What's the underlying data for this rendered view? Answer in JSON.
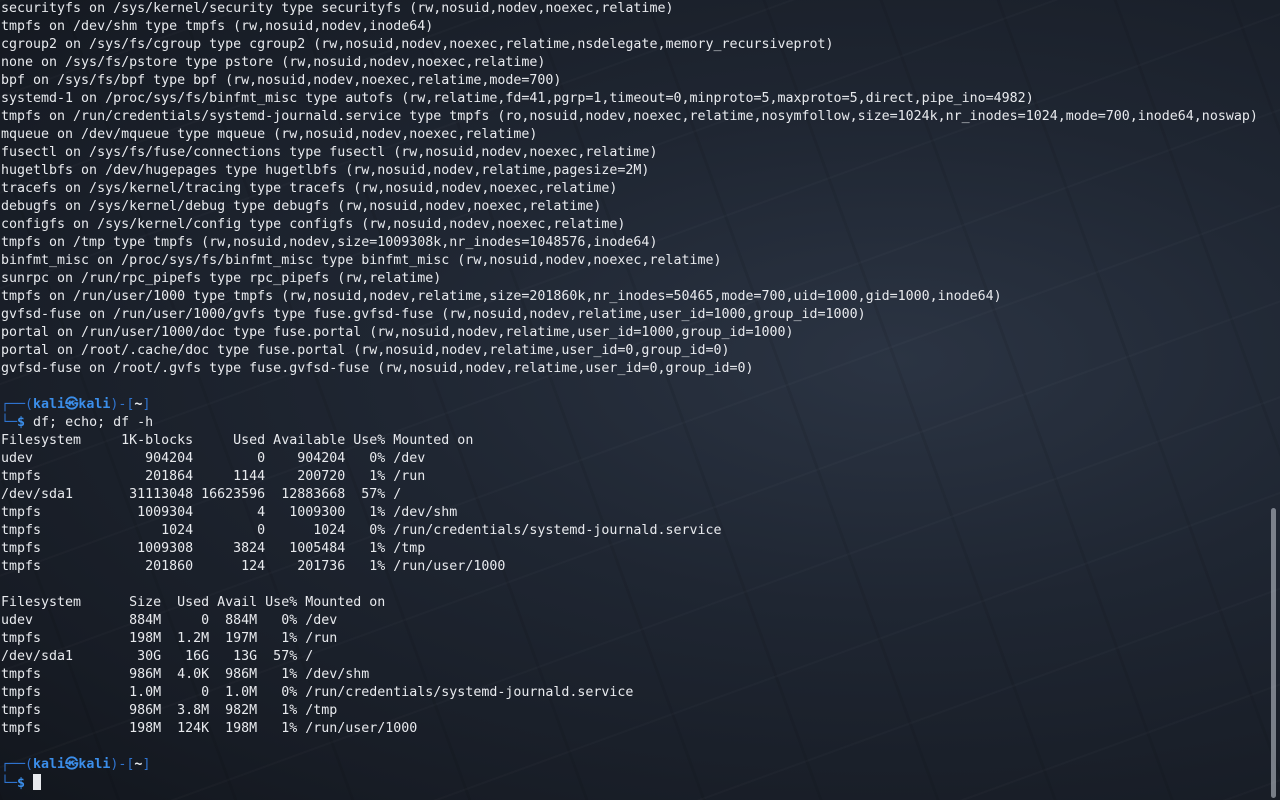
{
  "mount_output": [
    "securityfs on /sys/kernel/security type securityfs (rw,nosuid,nodev,noexec,relatime)",
    "tmpfs on /dev/shm type tmpfs (rw,nosuid,nodev,inode64)",
    "cgroup2 on /sys/fs/cgroup type cgroup2 (rw,nosuid,nodev,noexec,relatime,nsdelegate,memory_recursiveprot)",
    "none on /sys/fs/pstore type pstore (rw,nosuid,nodev,noexec,relatime)",
    "bpf on /sys/fs/bpf type bpf (rw,nosuid,nodev,noexec,relatime,mode=700)",
    "systemd-1 on /proc/sys/fs/binfmt_misc type autofs (rw,relatime,fd=41,pgrp=1,timeout=0,minproto=5,maxproto=5,direct,pipe_ino=4982)",
    "tmpfs on /run/credentials/systemd-journald.service type tmpfs (ro,nosuid,nodev,noexec,relatime,nosymfollow,size=1024k,nr_inodes=1024,mode=700,inode64,noswap)",
    "mqueue on /dev/mqueue type mqueue (rw,nosuid,nodev,noexec,relatime)",
    "fusectl on /sys/fs/fuse/connections type fusectl (rw,nosuid,nodev,noexec,relatime)",
    "hugetlbfs on /dev/hugepages type hugetlbfs (rw,nosuid,nodev,relatime,pagesize=2M)",
    "tracefs on /sys/kernel/tracing type tracefs (rw,nosuid,nodev,noexec,relatime)",
    "debugfs on /sys/kernel/debug type debugfs (rw,nosuid,nodev,noexec,relatime)",
    "configfs on /sys/kernel/config type configfs (rw,nosuid,nodev,noexec,relatime)",
    "tmpfs on /tmp type tmpfs (rw,nosuid,nodev,size=1009308k,nr_inodes=1048576,inode64)",
    "binfmt_misc on /proc/sys/fs/binfmt_misc type binfmt_misc (rw,nosuid,nodev,noexec,relatime)",
    "sunrpc on /run/rpc_pipefs type rpc_pipefs (rw,relatime)",
    "tmpfs on /run/user/1000 type tmpfs (rw,nosuid,nodev,relatime,size=201860k,nr_inodes=50465,mode=700,uid=1000,gid=1000,inode64)",
    "gvfsd-fuse on /run/user/1000/gvfs type fuse.gvfsd-fuse (rw,nosuid,nodev,relatime,user_id=1000,group_id=1000)",
    "portal on /run/user/1000/doc type fuse.portal (rw,nosuid,nodev,relatime,user_id=1000,group_id=1000)",
    "portal on /root/.cache/doc type fuse.portal (rw,nosuid,nodev,relatime,user_id=0,group_id=0)",
    "gvfsd-fuse on /root/.gvfs type fuse.gvfsd-fuse (rw,nosuid,nodev,relatime,user_id=0,group_id=0)"
  ],
  "prompt": {
    "top_open": "┌──(",
    "user": "kali",
    "at": "㉿",
    "host": "kali",
    "mid": ")-[",
    "path": "~",
    "close": "]",
    "bottom": "└─",
    "dollar": "$"
  },
  "command": "df; echo; df -h",
  "df_output": [
    "Filesystem     1K-blocks     Used Available Use% Mounted on",
    "udev              904204        0    904204   0% /dev",
    "tmpfs             201864     1144    200720   1% /run",
    "/dev/sda1       31113048 16623596  12883668  57% /",
    "tmpfs            1009304        4   1009300   1% /dev/shm",
    "tmpfs               1024        0      1024   0% /run/credentials/systemd-journald.service",
    "tmpfs            1009308     3824   1005484   1% /tmp",
    "tmpfs             201860      124    201736   1% /run/user/1000"
  ],
  "df_h_output": [
    "Filesystem      Size  Used Avail Use% Mounted on",
    "udev            884M     0  884M   0% /dev",
    "tmpfs           198M  1.2M  197M   1% /run",
    "/dev/sda1        30G   16G   13G  57% /",
    "tmpfs           986M  4.0K  986M   1% /dev/shm",
    "tmpfs           1.0M     0  1.0M   0% /run/credentials/systemd-journald.service",
    "tmpfs           986M  3.8M  982M   1% /tmp",
    "tmpfs           198M  124K  198M   1% /run/user/1000"
  ],
  "colors": {
    "prompt_accent": "#3b8eea",
    "text": "#e8eaee"
  }
}
